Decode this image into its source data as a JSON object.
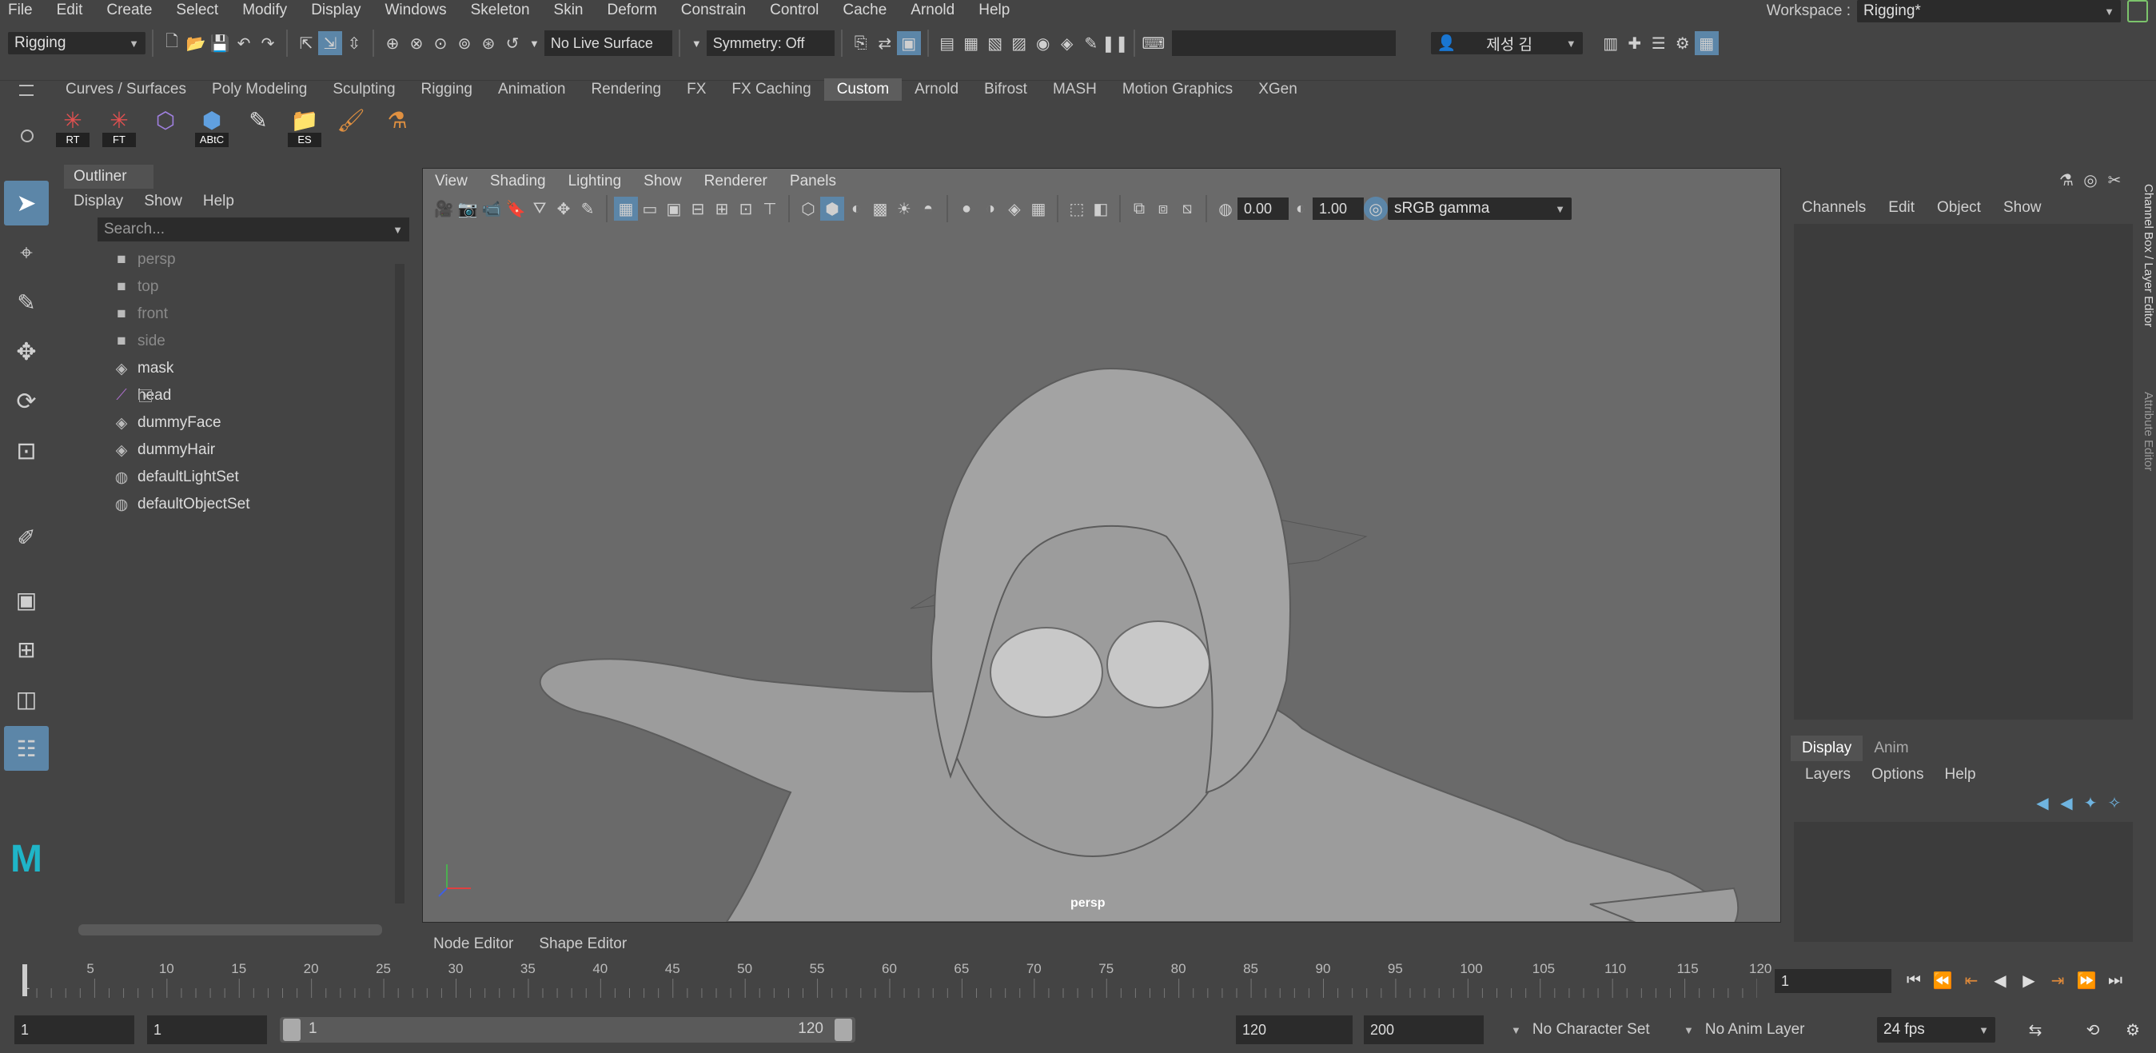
{
  "menubar": {
    "items": [
      "File",
      "Edit",
      "Create",
      "Select",
      "Modify",
      "Display",
      "Windows",
      "Skeleton",
      "Skin",
      "Deform",
      "Constrain",
      "Control",
      "Cache",
      "Arnold",
      "Help"
    ],
    "workspace_label": "Workspace :",
    "workspace_value": "Rigging*"
  },
  "statusline": {
    "mode_menu": "Rigging",
    "live_surface": "No Live Surface",
    "symmetry": "Symmetry: Off",
    "user_name": "제성 김"
  },
  "shelf": {
    "tabs": [
      "Curves / Surfaces",
      "Poly Modeling",
      "Sculpting",
      "Rigging",
      "Animation",
      "Rendering",
      "FX",
      "FX Caching",
      "Custom",
      "Arnold",
      "Bifrost",
      "MASH",
      "Motion Graphics",
      "XGen"
    ],
    "active_tab": "Custom",
    "icons": [
      {
        "label": "RT",
        "icon": "joint-tool-icon"
      },
      {
        "label": "FT",
        "icon": "joint-tool-icon"
      },
      {
        "label": "",
        "icon": "lattice-cube-icon"
      },
      {
        "label": "ABtC",
        "icon": "attach-blend-icon"
      },
      {
        "label": "",
        "icon": "paint-weights-icon"
      },
      {
        "label": "ES",
        "icon": "folder-script-icon"
      },
      {
        "label": "",
        "icon": "brush-tool-icon"
      },
      {
        "label": "",
        "icon": "teapot-icon"
      }
    ]
  },
  "outliner": {
    "title": "Outliner",
    "menu": [
      "Display",
      "Show",
      "Help"
    ],
    "search_placeholder": "Search...",
    "items": [
      {
        "name": "persp",
        "kind": "camera",
        "dim": true
      },
      {
        "name": "top",
        "kind": "camera",
        "dim": true
      },
      {
        "name": "front",
        "kind": "camera",
        "dim": true
      },
      {
        "name": "side",
        "kind": "camera",
        "dim": true
      },
      {
        "name": "mask",
        "kind": "mesh",
        "dim": false
      },
      {
        "name": "head",
        "kind": "joint",
        "dim": false
      },
      {
        "name": "dummyFace",
        "kind": "mesh",
        "dim": false
      },
      {
        "name": "dummyHair",
        "kind": "mesh",
        "dim": false
      },
      {
        "name": "defaultLightSet",
        "kind": "set",
        "dim": false
      },
      {
        "name": "defaultObjectSet",
        "kind": "set",
        "dim": false
      }
    ]
  },
  "viewport": {
    "menu": [
      "View",
      "Shading",
      "Lighting",
      "Show",
      "Renderer",
      "Panels"
    ],
    "exposure": "0.00",
    "gamma": "1.00",
    "color_space": "sRGB gamma",
    "camera_label": "persp"
  },
  "channelbox": {
    "menu": [
      "Channels",
      "Edit",
      "Object",
      "Show"
    ],
    "side_tabs": [
      "Channel Box / Layer Editor",
      "Attribute Editor"
    ]
  },
  "layereditor": {
    "tabs": [
      "Display",
      "Anim"
    ],
    "menu": [
      "Layers",
      "Options",
      "Help"
    ]
  },
  "bottom_tabs": [
    "Node Editor",
    "Shape Editor"
  ],
  "timeline": {
    "ticks": [
      "1",
      "5",
      "10",
      "15",
      "20",
      "25",
      "30",
      "35",
      "40",
      "45",
      "50",
      "55",
      "60",
      "65",
      "70",
      "75",
      "80",
      "85",
      "90",
      "95",
      "100",
      "105",
      "110",
      "115",
      "120"
    ],
    "current_frame": "1"
  },
  "rangebar": {
    "start": "1",
    "range_start": "1",
    "range_slider_start": "1",
    "range_slider_end": "120",
    "range_end": "120",
    "end": "200",
    "character_set": "No Character Set",
    "anim_layer": "No Anim Layer",
    "fps": "24 fps"
  }
}
